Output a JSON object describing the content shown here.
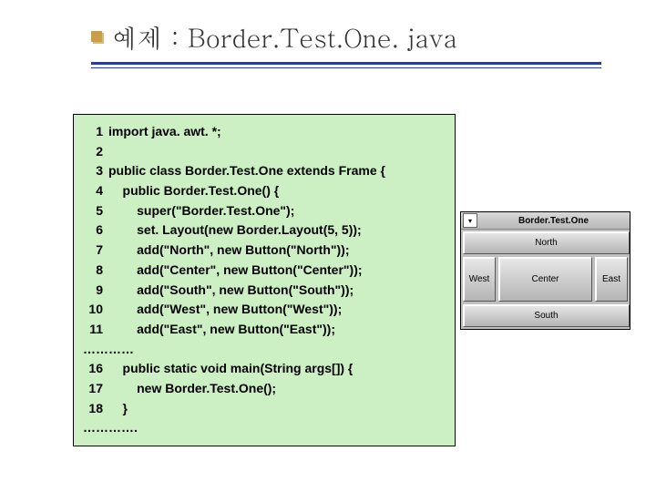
{
  "title": "예제 : Border.Test.One. java",
  "code": {
    "lines": [
      {
        "n": "1",
        "t": "import java. awt. *;"
      },
      {
        "n": "2",
        "t": ""
      },
      {
        "n": "3",
        "t": "public class Border.Test.One extends Frame {"
      },
      {
        "n": "4",
        "t": "    public Border.Test.One() {"
      },
      {
        "n": "5",
        "t": "        super(\"Border.Test.One\");"
      },
      {
        "n": "6",
        "t": "        set. Layout(new Border.Layout(5, 5));"
      },
      {
        "n": "7",
        "t": "        add(\"North\", new Button(\"North\"));"
      },
      {
        "n": "8",
        "t": "        add(\"Center\", new Button(\"Center\"));"
      },
      {
        "n": "9",
        "t": "        add(\"South\", new Button(\"South\"));"
      },
      {
        "n": "10",
        "t": "        add(\"West\", new Button(\"West\"));"
      },
      {
        "n": "11",
        "t": "        add(\"East\", new Button(\"East\"));"
      }
    ],
    "ellipsis1": "…………",
    "lines2": [
      {
        "n": "16",
        "t": "    public static void main(String args[]) {"
      },
      {
        "n": "17",
        "t": "        new Border.Test.One();"
      },
      {
        "n": "18",
        "t": "    }"
      }
    ],
    "ellipsis2": "…………."
  },
  "window": {
    "title": "Border.Test.One",
    "sysicon": "▾",
    "buttons": {
      "north": "North",
      "west": "West",
      "center": "Center",
      "east": "East",
      "south": "South"
    }
  }
}
